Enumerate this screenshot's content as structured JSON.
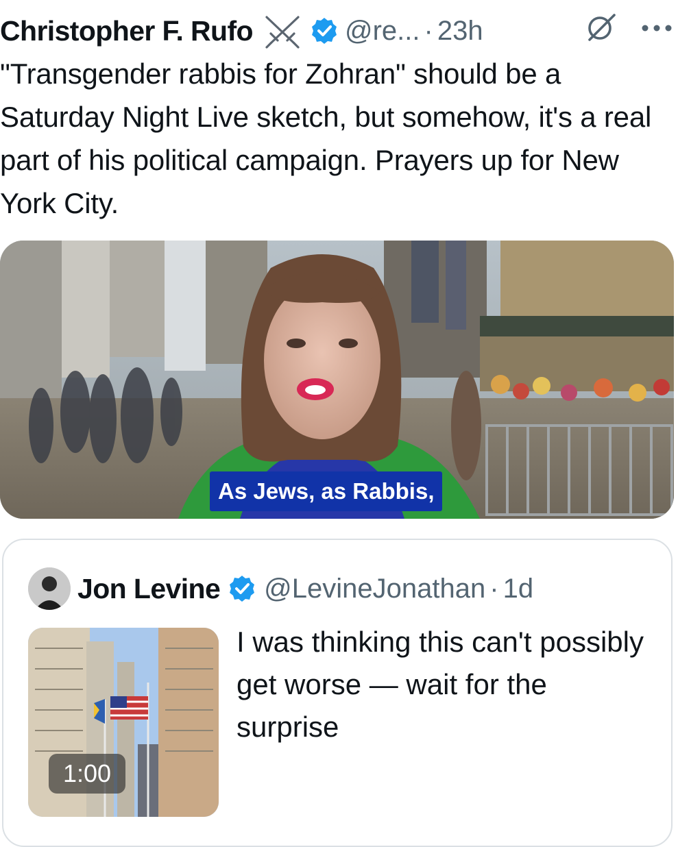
{
  "tweet": {
    "author_name": "Christopher F. Rufo",
    "handle": "@re...",
    "separator": "·",
    "time": "23h",
    "text": "\"Transgender rabbis for Zohran\" should be a Saturday Night Live sketch, but somehow, it's a real part of his political campaign. Prayers up for New York City.",
    "icons": {
      "badge": "crossed-swords-icon",
      "verified": "verified-badge-icon",
      "grok": "grok-icon",
      "more": "more-options-icon"
    },
    "media": {
      "caption": "As Jews, as Rabbis,"
    }
  },
  "quoted_tweet": {
    "author_name": "Jon Levine",
    "handle": "@LevineJonathan",
    "separator": "·",
    "time": "1d",
    "text": "I was thinking this can't possibly get worse — wait for the surprise",
    "video_duration": "1:00"
  },
  "colors": {
    "text_primary": "#0f1419",
    "text_secondary": "#536471",
    "verified_blue": "#1d9bf0",
    "caption_bg": "#1133a8",
    "border": "#dbe0e4"
  }
}
